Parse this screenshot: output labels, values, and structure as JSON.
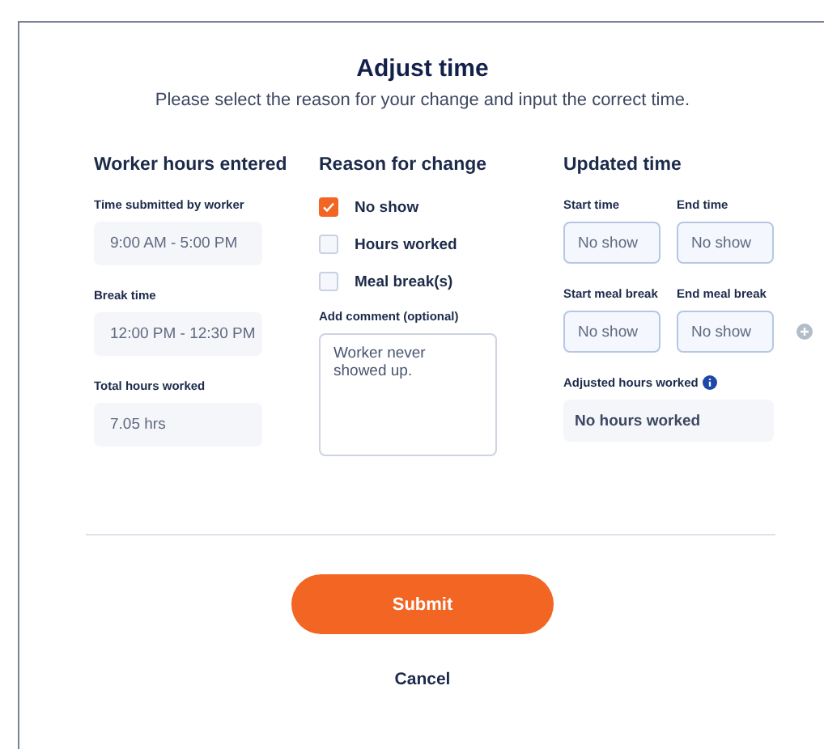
{
  "title": "Adjust time",
  "subtitle": "Please select the reason for your change and input the correct time.",
  "worker_hours": {
    "heading": "Worker hours entered",
    "fields": [
      {
        "label": "Time submitted by worker",
        "value": "9:00 AM - 5:00 PM"
      },
      {
        "label": "Break time",
        "value": "12:00 PM - 12:30 PM"
      },
      {
        "label": "Total hours worked",
        "value": "7.05 hrs"
      }
    ]
  },
  "reason": {
    "heading": "Reason for change",
    "options": [
      {
        "label": "No show",
        "checked": true
      },
      {
        "label": "Hours worked",
        "checked": false
      },
      {
        "label": "Meal break(s)",
        "checked": false
      }
    ],
    "comment": {
      "label": "Add comment (optional)",
      "value": "Worker never showed up."
    }
  },
  "updated_time": {
    "heading": "Updated time",
    "rows": [
      [
        {
          "label": "Start time",
          "value": "No show"
        },
        {
          "label": "End time",
          "value": "No show"
        }
      ],
      [
        {
          "label": "Start meal break",
          "value": "No show"
        },
        {
          "label": "End meal break",
          "value": "No show"
        }
      ]
    ],
    "adjusted": {
      "label": "Adjusted hours worked",
      "value": "No hours worked"
    }
  },
  "submit": "Submit",
  "cancel": "Cancel"
}
